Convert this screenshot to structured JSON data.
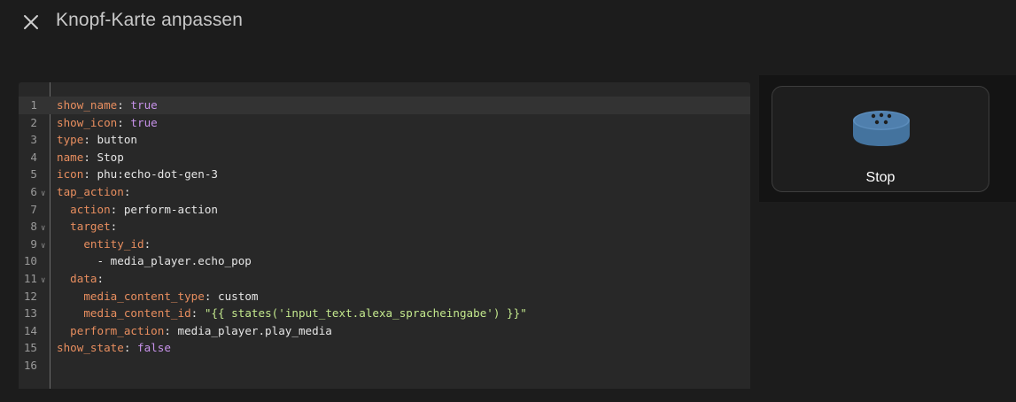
{
  "dialog": {
    "title": "Knopf-Karte anpassen",
    "close_icon": "close-icon"
  },
  "editor": {
    "lines": [
      {
        "num": "1",
        "fold": false,
        "active": true,
        "tokens": [
          {
            "t": "show_name",
            "c": "k"
          },
          {
            "t": ": ",
            "c": "p"
          },
          {
            "t": "true",
            "c": "b"
          }
        ]
      },
      {
        "num": "2",
        "fold": false,
        "active": false,
        "tokens": [
          {
            "t": "show_icon",
            "c": "k"
          },
          {
            "t": ": ",
            "c": "p"
          },
          {
            "t": "true",
            "c": "b"
          }
        ]
      },
      {
        "num": "3",
        "fold": false,
        "active": false,
        "tokens": [
          {
            "t": "type",
            "c": "k"
          },
          {
            "t": ": button",
            "c": "p"
          }
        ]
      },
      {
        "num": "4",
        "fold": false,
        "active": false,
        "tokens": [
          {
            "t": "name",
            "c": "k"
          },
          {
            "t": ": Stop",
            "c": "p"
          }
        ]
      },
      {
        "num": "5",
        "fold": false,
        "active": false,
        "tokens": [
          {
            "t": "icon",
            "c": "k"
          },
          {
            "t": ": phu:echo-dot-gen-3",
            "c": "p"
          }
        ]
      },
      {
        "num": "6",
        "fold": true,
        "active": false,
        "tokens": [
          {
            "t": "tap_action",
            "c": "k"
          },
          {
            "t": ":",
            "c": "p"
          }
        ]
      },
      {
        "num": "7",
        "fold": false,
        "active": false,
        "tokens": [
          {
            "t": "  ",
            "c": "p"
          },
          {
            "t": "action",
            "c": "k"
          },
          {
            "t": ": perform-action",
            "c": "p"
          }
        ]
      },
      {
        "num": "8",
        "fold": true,
        "active": false,
        "tokens": [
          {
            "t": "  ",
            "c": "p"
          },
          {
            "t": "target",
            "c": "k"
          },
          {
            "t": ":",
            "c": "p"
          }
        ]
      },
      {
        "num": "9",
        "fold": true,
        "active": false,
        "tokens": [
          {
            "t": "    ",
            "c": "p"
          },
          {
            "t": "entity_id",
            "c": "k"
          },
          {
            "t": ":",
            "c": "p"
          }
        ]
      },
      {
        "num": "10",
        "fold": false,
        "active": false,
        "tokens": [
          {
            "t": "      - media_player.echo_pop",
            "c": "p"
          }
        ]
      },
      {
        "num": "11",
        "fold": true,
        "active": false,
        "tokens": [
          {
            "t": "  ",
            "c": "p"
          },
          {
            "t": "data",
            "c": "k"
          },
          {
            "t": ":",
            "c": "p"
          }
        ]
      },
      {
        "num": "12",
        "fold": false,
        "active": false,
        "tokens": [
          {
            "t": "    ",
            "c": "p"
          },
          {
            "t": "media_content_type",
            "c": "k"
          },
          {
            "t": ": custom",
            "c": "p"
          }
        ]
      },
      {
        "num": "13",
        "fold": false,
        "active": false,
        "tokens": [
          {
            "t": "    ",
            "c": "p"
          },
          {
            "t": "media_content_id",
            "c": "k"
          },
          {
            "t": ": ",
            "c": "p"
          },
          {
            "t": "\"{{ states('input_text.alexa_spracheingabe') }}\"",
            "c": "s"
          }
        ]
      },
      {
        "num": "14",
        "fold": false,
        "active": false,
        "tokens": [
          {
            "t": "  ",
            "c": "p"
          },
          {
            "t": "perform_action",
            "c": "k"
          },
          {
            "t": ": media_player.play_media",
            "c": "p"
          }
        ]
      },
      {
        "num": "15",
        "fold": false,
        "active": false,
        "tokens": [
          {
            "t": "show_state",
            "c": "k"
          },
          {
            "t": ": ",
            "c": "p"
          },
          {
            "t": "false",
            "c": "b"
          }
        ]
      },
      {
        "num": "16",
        "fold": false,
        "active": false,
        "tokens": []
      }
    ]
  },
  "preview": {
    "card_label": "Stop",
    "card_icon": "echo-dot-icon",
    "icon_color": "#44739e"
  },
  "colors": {
    "background": "#1c1c1c",
    "editor_background": "#282828",
    "key": "#e88e5f",
    "boolean": "#c792ea",
    "string": "#c3e88d"
  }
}
